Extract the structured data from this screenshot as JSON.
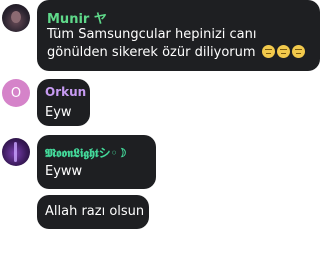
{
  "messages": [
    {
      "author": "Munir ヤ",
      "author_color": "#5fd98a",
      "avatar_icon": "user-photo-icon",
      "lines": [
        "Tüm Samsungcular hepinizi canı",
        "gönülden sikerek özür diliyorum"
      ],
      "emoji_icon": "pensive-face-icon",
      "emoji_count": 3
    },
    {
      "author": "Orkun",
      "author_color": "#c79bf2",
      "avatar_initial": "O",
      "avatar_color": "#d583c9",
      "lines": [
        "Eyw"
      ]
    },
    {
      "author": "𝕸𝖔𝖔𝖓𝕷𝖎𝖌𝖍𝖙シ◦☽",
      "author_color": "#43d99a",
      "avatar_icon": "user-photo-icon",
      "lines": [
        "Eyww",
        "Allah razı olsun"
      ]
    }
  ]
}
